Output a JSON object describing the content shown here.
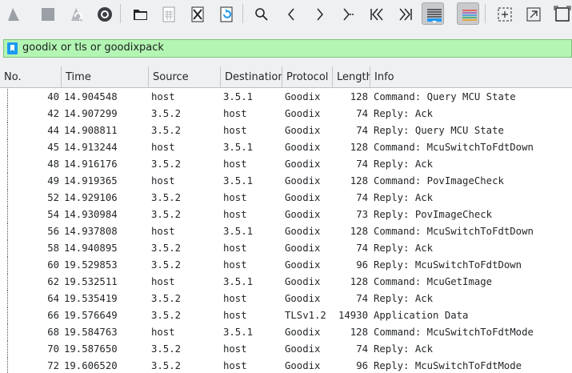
{
  "toolbar": {
    "buttons": [
      {
        "name": "start-capture-icon"
      },
      {
        "name": "stop-capture-icon"
      },
      {
        "name": "restart-capture-icon"
      },
      {
        "name": "capture-options-icon"
      },
      {
        "name": "open-file-icon"
      },
      {
        "name": "save-file-icon"
      },
      {
        "name": "close-file-icon"
      },
      {
        "name": "reload-file-icon"
      },
      {
        "name": "find-packet-icon"
      },
      {
        "name": "go-back-icon"
      },
      {
        "name": "go-forward-icon"
      },
      {
        "name": "go-to-packet-icon"
      },
      {
        "name": "go-first-icon"
      },
      {
        "name": "go-last-icon"
      },
      {
        "name": "autoscroll-icon"
      },
      {
        "name": "colorize-icon"
      },
      {
        "name": "zoom-in-icon"
      },
      {
        "name": "zoom-out-icon"
      },
      {
        "name": "normal-size-icon"
      }
    ]
  },
  "filter": {
    "value": "goodix or tls or goodixpack"
  },
  "columns": [
    "No.",
    "Time",
    "Source",
    "Destination",
    "Protocol",
    "Length",
    "Info"
  ],
  "packets": [
    {
      "no": "40",
      "time": "14.904548",
      "src": "host",
      "dst": "3.5.1",
      "proto": "Goodix",
      "len": "128",
      "info": "Command: Query MCU State"
    },
    {
      "no": "42",
      "time": "14.907299",
      "src": "3.5.2",
      "dst": "host",
      "proto": "Goodix",
      "len": "74",
      "info": "Reply: Ack"
    },
    {
      "no": "44",
      "time": "14.908811",
      "src": "3.5.2",
      "dst": "host",
      "proto": "Goodix",
      "len": "74",
      "info": "Reply: Query MCU State"
    },
    {
      "no": "45",
      "time": "14.913244",
      "src": "host",
      "dst": "3.5.1",
      "proto": "Goodix",
      "len": "128",
      "info": "Command: McuSwitchToFdtDown"
    },
    {
      "no": "48",
      "time": "14.916176",
      "src": "3.5.2",
      "dst": "host",
      "proto": "Goodix",
      "len": "74",
      "info": "Reply: Ack"
    },
    {
      "no": "49",
      "time": "14.919365",
      "src": "host",
      "dst": "3.5.1",
      "proto": "Goodix",
      "len": "128",
      "info": "Command: PovImageCheck"
    },
    {
      "no": "52",
      "time": "14.929106",
      "src": "3.5.2",
      "dst": "host",
      "proto": "Goodix",
      "len": "74",
      "info": "Reply: Ack"
    },
    {
      "no": "54",
      "time": "14.930984",
      "src": "3.5.2",
      "dst": "host",
      "proto": "Goodix",
      "len": "73",
      "info": "Reply: PovImageCheck"
    },
    {
      "no": "56",
      "time": "14.937808",
      "src": "host",
      "dst": "3.5.1",
      "proto": "Goodix",
      "len": "128",
      "info": "Command: McuSwitchToFdtDown"
    },
    {
      "no": "58",
      "time": "14.940895",
      "src": "3.5.2",
      "dst": "host",
      "proto": "Goodix",
      "len": "74",
      "info": "Reply: Ack"
    },
    {
      "no": "60",
      "time": "19.529853",
      "src": "3.5.2",
      "dst": "host",
      "proto": "Goodix",
      "len": "96",
      "info": "Reply: McuSwitchToFdtDown"
    },
    {
      "no": "62",
      "time": "19.532511",
      "src": "host",
      "dst": "3.5.1",
      "proto": "Goodix",
      "len": "128",
      "info": "Command: McuGetImage"
    },
    {
      "no": "64",
      "time": "19.535419",
      "src": "3.5.2",
      "dst": "host",
      "proto": "Goodix",
      "len": "74",
      "info": "Reply: Ack"
    },
    {
      "no": "66",
      "time": "19.576649",
      "src": "3.5.2",
      "dst": "host",
      "proto": "TLSv1.2",
      "len": "14930",
      "info": "Application Data"
    },
    {
      "no": "68",
      "time": "19.584763",
      "src": "host",
      "dst": "3.5.1",
      "proto": "Goodix",
      "len": "128",
      "info": "Command: McuSwitchToFdtMode"
    },
    {
      "no": "70",
      "time": "19.587650",
      "src": "3.5.2",
      "dst": "host",
      "proto": "Goodix",
      "len": "74",
      "info": "Reply: Ack"
    },
    {
      "no": "72",
      "time": "19.606520",
      "src": "3.5.2",
      "dst": "host",
      "proto": "Goodix",
      "len": "96",
      "info": "Reply: McuSwitchToFdtMode"
    }
  ]
}
